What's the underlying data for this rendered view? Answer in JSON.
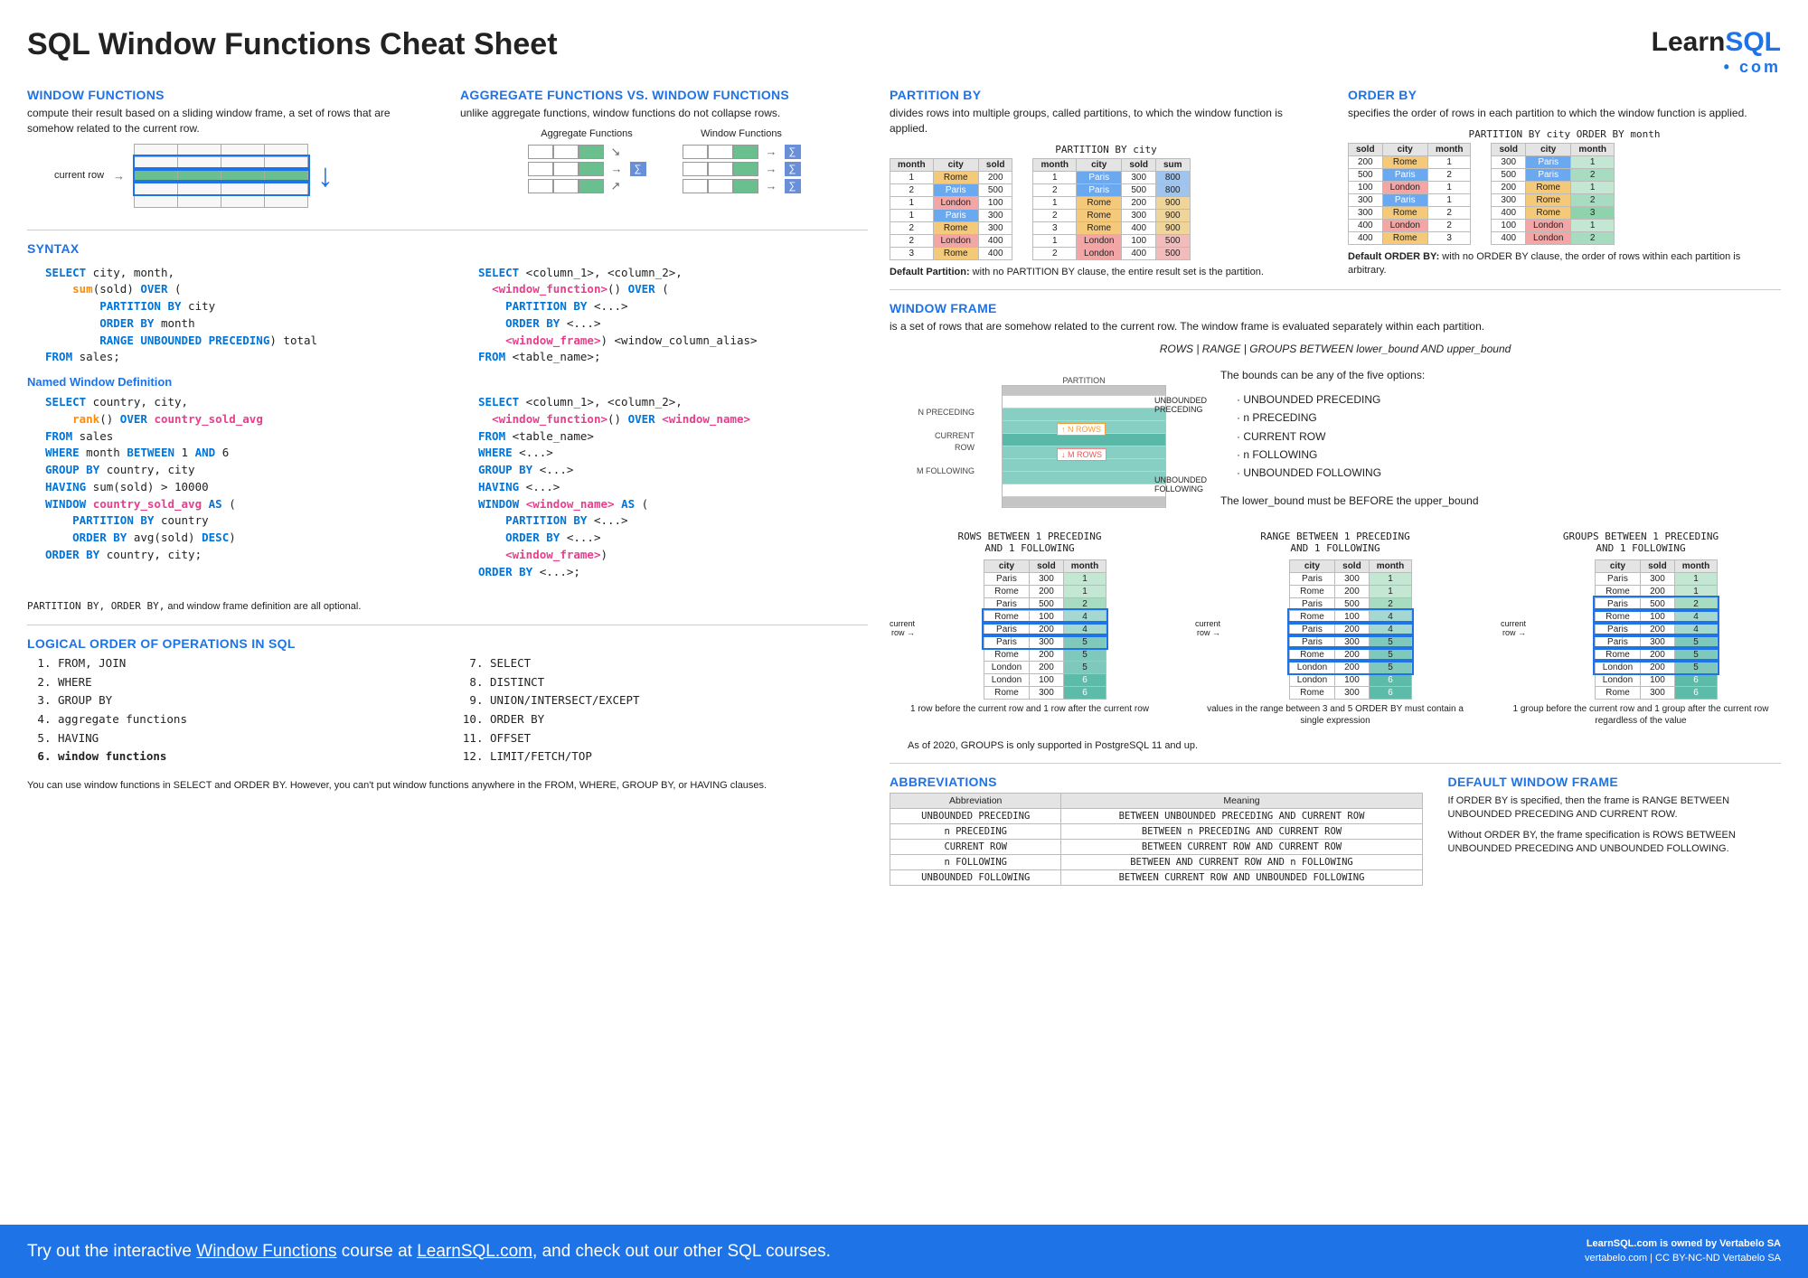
{
  "title": "SQL Window Functions Cheat Sheet",
  "logo": {
    "learn": "Learn",
    "sql": "SQL",
    "com": "• com"
  },
  "left": {
    "wf": {
      "h": "WINDOW FUNCTIONS",
      "d": "compute their result based on a sliding window frame, a set of rows that are somehow related to the current row.",
      "curr": "current row"
    },
    "agg": {
      "h": "AGGREGATE FUNCTIONS VS. WINDOW FUNCTIONS",
      "d": "unlike aggregate functions, window functions do not collapse rows.",
      "l1": "Aggregate Functions",
      "l2": "Window Functions"
    },
    "syntax": {
      "h": "SYNTAX"
    },
    "named": {
      "h": "Named Window Definition",
      "note": "PARTITION BY, ORDER BY, and window frame definition are all optional."
    },
    "order": {
      "h": "LOGICAL ORDER OF OPERATIONS IN SQL",
      "items": [
        "FROM, JOIN",
        "WHERE",
        "GROUP BY",
        "aggregate functions",
        "HAVING",
        "window functions",
        "SELECT",
        "DISTINCT",
        "UNION/INTERSECT/EXCEPT",
        "ORDER BY",
        "OFFSET",
        "LIMIT/FETCH/TOP"
      ],
      "note": "You can use window functions in SELECT and ORDER BY. However, you can't put window functions anywhere in the FROM, WHERE, GROUP BY, or HAVING clauses."
    }
  },
  "right": {
    "part": {
      "h": "PARTITION BY",
      "d": "divides rows into multiple groups, called partitions, to which the window function is applied.",
      "cap": "PARTITION BY city",
      "cols1": [
        "month",
        "city",
        "sold"
      ],
      "cols2": [
        "month",
        "city",
        "sold",
        "sum"
      ],
      "t1": [
        [
          "1",
          "Rome",
          "200"
        ],
        [
          "2",
          "Paris",
          "500"
        ],
        [
          "1",
          "London",
          "100"
        ],
        [
          "1",
          "Paris",
          "300"
        ],
        [
          "2",
          "Rome",
          "300"
        ],
        [
          "2",
          "London",
          "400"
        ],
        [
          "3",
          "Rome",
          "400"
        ]
      ],
      "t2": [
        [
          "1",
          "Paris",
          "300",
          "800"
        ],
        [
          "2",
          "Paris",
          "500",
          "800"
        ],
        [
          "1",
          "Rome",
          "200",
          "900"
        ],
        [
          "2",
          "Rome",
          "300",
          "900"
        ],
        [
          "3",
          "Rome",
          "400",
          "900"
        ],
        [
          "1",
          "London",
          "100",
          "500"
        ],
        [
          "2",
          "London",
          "400",
          "500"
        ]
      ],
      "note_b": "Default Partition:",
      "note": " with no PARTITION BY clause, the entire result set is the partition."
    },
    "ord": {
      "h": "ORDER BY",
      "d": "specifies the order of rows in each partition to which the window function is applied.",
      "cap": "PARTITION BY city ORDER BY month",
      "cols": [
        "sold",
        "city",
        "month"
      ],
      "t1": [
        [
          "200",
          "Rome",
          "1"
        ],
        [
          "500",
          "Paris",
          "2"
        ],
        [
          "100",
          "London",
          "1"
        ],
        [
          "300",
          "Paris",
          "1"
        ],
        [
          "300",
          "Rome",
          "2"
        ],
        [
          "400",
          "London",
          "2"
        ],
        [
          "400",
          "Rome",
          "3"
        ]
      ],
      "t2": [
        [
          "300",
          "Paris",
          "1"
        ],
        [
          "500",
          "Paris",
          "2"
        ],
        [
          "200",
          "Rome",
          "1"
        ],
        [
          "300",
          "Rome",
          "2"
        ],
        [
          "400",
          "Rome",
          "3"
        ],
        [
          "100",
          "London",
          "1"
        ],
        [
          "400",
          "London",
          "2"
        ]
      ],
      "note_b": "Default ORDER BY:",
      "note": " with no ORDER BY clause, the order of rows within each partition is arbitrary."
    },
    "frame": {
      "h": "WINDOW FRAME",
      "d": "is a set of rows that are somehow related to the current row. The window frame is evaluated separately within each partition.",
      "syntax": "ROWS | RANGE | GROUPS BETWEEN lower_bound AND upper_bound",
      "labels": {
        "part": "PARTITION",
        "up": "UNBOUNDED\nPRECEDING",
        "np": "N PRECEDING",
        "cr": "CURRENT\nROW",
        "mf": "M FOLLOWING",
        "uf": "UNBOUNDED\nFOLLOWING",
        "nrows": "N ROWS",
        "mrows": "M ROWS"
      },
      "bounds_intro": "The bounds can be any of the five options:",
      "bounds": [
        "UNBOUNDED PRECEDING",
        "n PRECEDING",
        "CURRENT ROW",
        "n FOLLOWING",
        "UNBOUNDED FOLLOWING"
      ],
      "bounds_note": "The lower_bound must be BEFORE the upper_bound",
      "ex_cols": [
        "city",
        "sold",
        "month"
      ],
      "ex_data": [
        [
          "Paris",
          "300",
          "1"
        ],
        [
          "Rome",
          "200",
          "1"
        ],
        [
          "Paris",
          "500",
          "2"
        ],
        [
          "Rome",
          "100",
          "4"
        ],
        [
          "Paris",
          "200",
          "4"
        ],
        [
          "Paris",
          "300",
          "5"
        ],
        [
          "Rome",
          "200",
          "5"
        ],
        [
          "London",
          "200",
          "5"
        ],
        [
          "London",
          "100",
          "6"
        ],
        [
          "Rome",
          "300",
          "6"
        ]
      ],
      "ex1_t": "ROWS BETWEEN 1 PRECEDING\n    AND 1 FOLLOWING",
      "ex2_t": "RANGE BETWEEN 1 PRECEDING\n    AND 1 FOLLOWING",
      "ex3_t": "GROUPS BETWEEN 1 PRECEDING\n    AND 1 FOLLOWING",
      "ex1_n": "1 row before the current row and 1 row after the current row",
      "ex2_n": "values in the range between 3 and 5 ORDER BY must contain a single expression",
      "ex3_n": "1 group before the current row and 1 group after the current row regardless of the value",
      "curr": "current\nrow",
      "groups_note": "As of 2020, GROUPS is only supported in PostgreSQL 11 and up."
    },
    "abbr": {
      "h": "ABBREVIATIONS",
      "t": [
        [
          "Abbreviation",
          "Meaning"
        ],
        [
          "UNBOUNDED PRECEDING",
          "BETWEEN UNBOUNDED PRECEDING AND CURRENT ROW"
        ],
        [
          "n PRECEDING",
          "BETWEEN n PRECEDING AND CURRENT ROW"
        ],
        [
          "CURRENT ROW",
          "BETWEEN CURRENT ROW AND CURRENT ROW"
        ],
        [
          "n FOLLOWING",
          "BETWEEN AND CURRENT ROW AND n FOLLOWING"
        ],
        [
          "UNBOUNDED FOLLOWING",
          "BETWEEN CURRENT ROW AND UNBOUNDED FOLLOWING"
        ]
      ]
    },
    "def": {
      "h": "DEFAULT WINDOW FRAME",
      "p1": "If ORDER BY is specified, then the frame is RANGE BETWEEN UNBOUNDED PRECEDING AND CURRENT ROW.",
      "p2": "Without ORDER BY, the frame specification is ROWS BETWEEN UNBOUNDED PRECEDING AND UNBOUNDED FOLLOWING."
    }
  },
  "footer": {
    "l1": "Try out the interactive ",
    "la": "Window Functions",
    "l2": " course at ",
    "lb": "LearnSQL.com",
    "l3": ", and check out our other SQL courses.",
    "r1": "LearnSQL.com is owned by Vertabelo SA",
    "r2": "vertabelo.com | CC BY-NC-ND Vertabelo SA"
  }
}
